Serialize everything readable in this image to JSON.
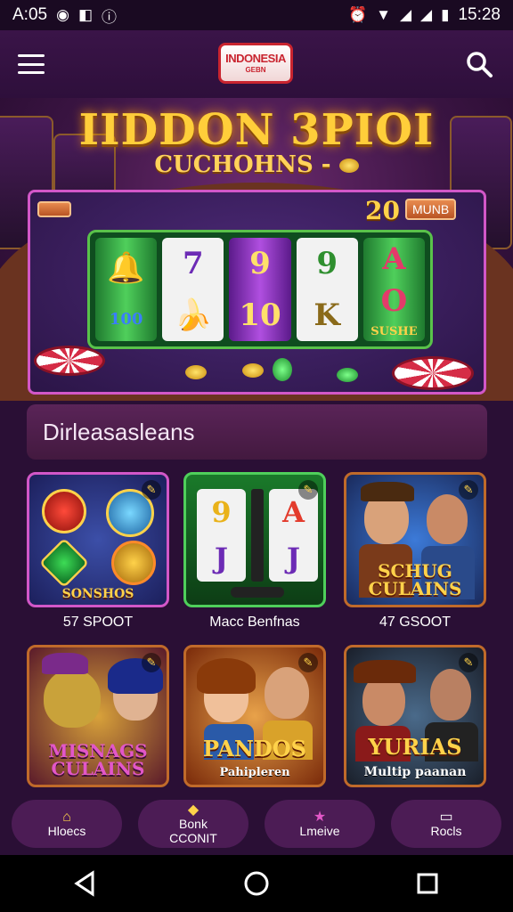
{
  "status_bar": {
    "time_left": "A:05",
    "time_right": "15:28"
  },
  "header": {
    "logo_line1": "INDONESIA",
    "logo_line2": "GEBN",
    "menu_icon": "hamburger-icon",
    "search_icon": "search-icon"
  },
  "hero": {
    "title": "IIDDON 3PIOI",
    "subtitle": "CUCHOHNS -",
    "badge_left": "",
    "badge_number": "20",
    "badge_right": "MUNB",
    "reel_caption_left": "100",
    "reel_caption_right": "SUSHE"
  },
  "section": {
    "title": "Dirleasasleans"
  },
  "games": [
    {
      "art_text": "SONSHOS",
      "label": "57 SPOOT"
    },
    {
      "art_text": "",
      "label": "Macc Benfnas"
    },
    {
      "art_text": "SCHUG CULAINS",
      "label": "47 GSOOT"
    },
    {
      "art_text": "MISNAGS CULAINS",
      "label": ""
    },
    {
      "art_text": "PANDOS",
      "sub_text": "Pahipleren",
      "label": ""
    },
    {
      "art_text": "YURIAS",
      "sub_text": "Multip paanan",
      "label": ""
    }
  ],
  "bottom_nav": [
    {
      "label": "Hloecs",
      "icon": "home-icon"
    },
    {
      "label": "Bonk\nCCONIT",
      "icon": "bonus-icon"
    },
    {
      "label": "Lmeive",
      "icon": "live-icon"
    },
    {
      "label": "Rocls",
      "icon": "tools-icon"
    }
  ],
  "colors": {
    "accent": "#d257c8",
    "gold": "#ffd24a",
    "bg": "#2a0f35"
  }
}
